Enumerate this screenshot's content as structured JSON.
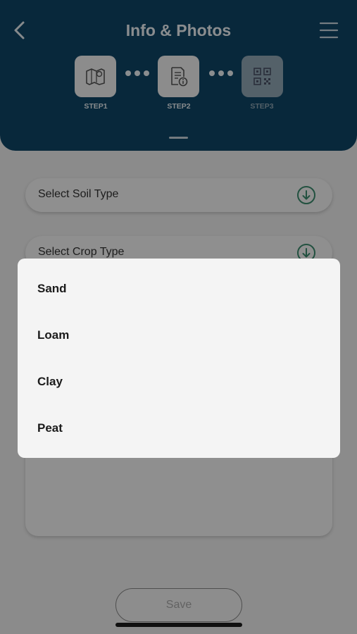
{
  "header": {
    "title": "Info & Photos",
    "steps": [
      {
        "label": "STEP1",
        "icon": "map-icon"
      },
      {
        "label": "STEP2",
        "icon": "document-info-icon"
      },
      {
        "label": "STEP3",
        "icon": "qr-code-icon"
      }
    ]
  },
  "form": {
    "soil_type_placeholder": "Select Soil Type",
    "crop_type_placeholder": "Select Crop Type",
    "save_label": "Save"
  },
  "dropdown": {
    "options": [
      "Sand",
      "Loam",
      "Clay",
      "Peat"
    ]
  },
  "colors": {
    "header_bg": "#0f4667",
    "accent_green": "#3c8c6e"
  }
}
